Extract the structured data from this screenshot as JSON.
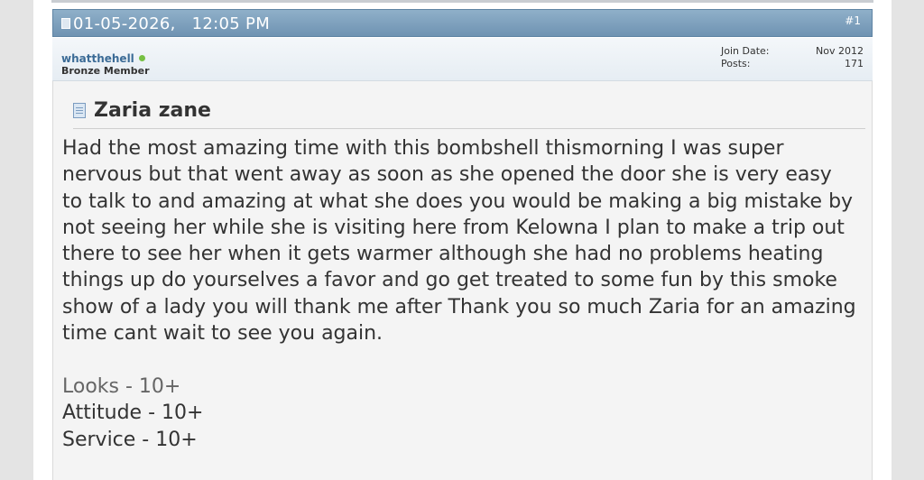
{
  "post": {
    "date": "01-05-2026,",
    "time": "12:05 PM",
    "number": "#1",
    "author": {
      "username": "whatthehell",
      "status": "online",
      "title": "Bronze Member",
      "join_date_label": "Join Date:",
      "join_date": "Nov 2012",
      "posts_label": "Posts:",
      "posts": "171"
    },
    "title": "Zaria zane",
    "body": "Had the most amazing time with this bombshell thismorning I was super nervous but that went away as soon as she opened the door she is very easy to talk to and amazing at what she does you would be making a big mistake by not seeing her while she is visiting here from Kelowna I plan to make a trip out there to see her when it gets warmer although she had no problems heating things up do yourselves a favor and go get treated to some fun by this smoke show of a lady you will thank me after Thank you so much Zaria for an amazing time cant wait to see you again.",
    "ratings": [
      "Looks - 10+",
      "Attitude - 10+",
      "Service - 10+"
    ]
  },
  "colors": {
    "header_bg": "#7a9dbb",
    "username": "#3b6b96",
    "online": "#76c043",
    "body_bg": "#f4f4f4"
  },
  "icons": {
    "post_status": "post-status-icon",
    "thread_title": "document-icon",
    "online_indicator": "online-dot-icon"
  }
}
